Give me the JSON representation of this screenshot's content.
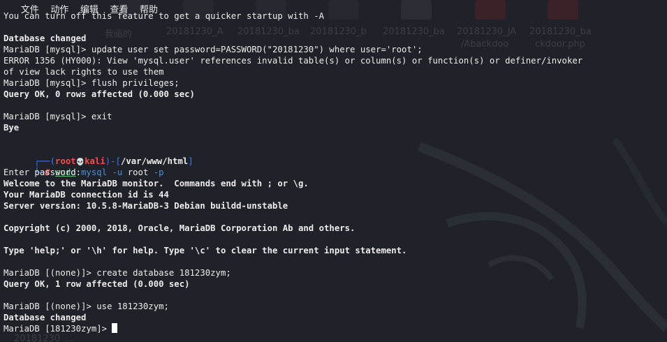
{
  "menubar": {
    "items": [
      "文件",
      "动作",
      "编辑",
      "查看",
      "帮助"
    ]
  },
  "desktop": {
    "icons": [
      {
        "label": "我画的"
      },
      {
        "label": "20181230_A"
      },
      {
        "label": "20181230_ba"
      },
      {
        "label": "20181230_b"
      },
      {
        "label": "20181230_ba"
      },
      {
        "label": "20181230_JA",
        "sublabel": "/Abackdoo"
      },
      {
        "label": "20181230_ba",
        "sublabel": "ckdoor.php"
      }
    ],
    "bottom_label": "20181230_..."
  },
  "terminal": {
    "l0": "You can turn off this feature to get a quicker startup with -A",
    "l2": "Database changed",
    "l3": "MariaDB [mysql]> update user set password=PASSWORD(\"20181230\") where user='root';",
    "l4": "ERROR 1356 (HY000): View 'mysql.user' references invalid table(s) or column(s) or function(s) or definer/invoker",
    "l5": "of view lack rights to use them",
    "l6": "MariaDB [mysql]> flush privileges;",
    "l7": "Query OK, 0 rows affected (0.000 sec)",
    "l9": "MariaDB [mysql]> exit",
    "l10": "Bye",
    "prompt": {
      "open": "┌──(",
      "user": "root",
      "skull": "💀",
      "host": "kali",
      "mid": ")-[",
      "path": "/var/www/html",
      "close": "]",
      "second": "└─",
      "hash": "#",
      "cmd_sudo": "sudo",
      "cmd_mysql": "mysql",
      "cmd_u": "-u",
      "cmd_root": "root",
      "cmd_p": "-p"
    },
    "l14": "Enter password:",
    "l15": "Welcome to the MariaDB monitor.  Commands end with ; or \\g.",
    "l16": "Your MariaDB connection id is 44",
    "l17": "Server version: 10.5.8-MariaDB-3 Debian buildd-unstable",
    "l19": "Copyright (c) 2000, 2018, Oracle, MariaDB Corporation Ab and others.",
    "l21": "Type 'help;' or '\\h' for help. Type '\\c' to clear the current input statement.",
    "l23": "MariaDB [(none)]> create database 181230zym;",
    "l24": "Query OK, 1 row affected (0.000 sec)",
    "l26": "MariaDB [(none)]> use 181230zym;",
    "l27": "Database changed",
    "l28": "MariaDB [181230zym]> "
  }
}
